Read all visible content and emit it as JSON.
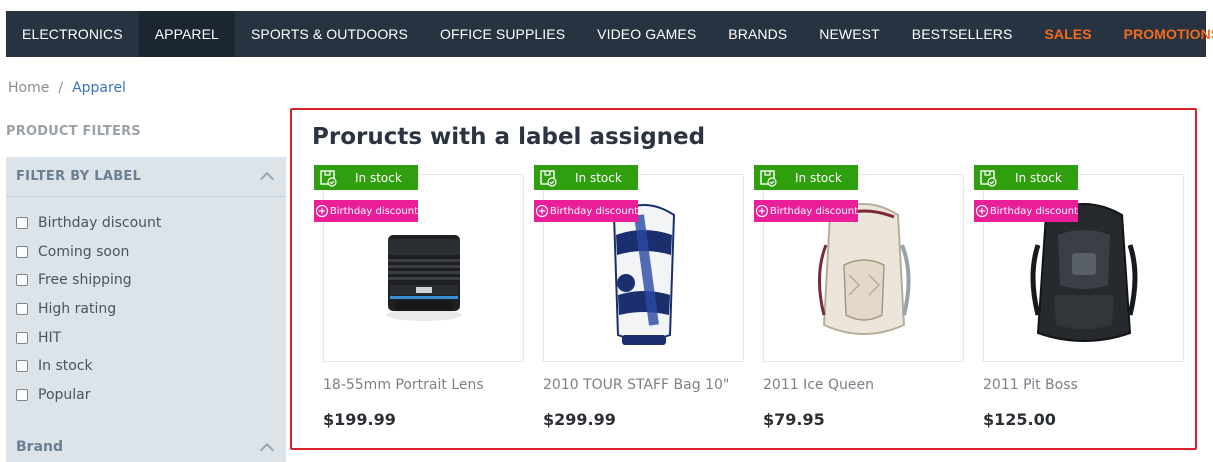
{
  "nav": {
    "items": [
      {
        "label": "ELECTRONICS"
      },
      {
        "label": "APPAREL"
      },
      {
        "label": "SPORTS & OUTDOORS"
      },
      {
        "label": "OFFICE SUPPLIES"
      },
      {
        "label": "VIDEO GAMES"
      },
      {
        "label": "BRANDS"
      },
      {
        "label": "NEWEST"
      },
      {
        "label": "BESTSELLERS"
      },
      {
        "label": "SALES"
      },
      {
        "label": "PROMOTIONS"
      }
    ]
  },
  "breadcrumb": {
    "home": "Home",
    "separator": "/",
    "current": "Apparel"
  },
  "sidebar": {
    "title": "PRODUCT FILTERS",
    "label_filter": {
      "title": "FILTER BY LABEL",
      "options": [
        "Birthday discount",
        "Coming soon",
        "Free shipping",
        "High rating",
        "HIT",
        "In stock",
        "Popular"
      ]
    },
    "brand": {
      "title": "Brand"
    }
  },
  "section": {
    "title": "Proructs with a label assigned"
  },
  "products": [
    {
      "name": "18-55mm Portrait Lens",
      "price": "$199.99",
      "stock_label": "In stock",
      "promo_label": "Birthday discount"
    },
    {
      "name": "2010 TOUR STAFF Bag 10\"",
      "price": "$299.99",
      "stock_label": "In stock",
      "promo_label": "Birthday discount"
    },
    {
      "name": "2011 Ice Queen",
      "price": "$79.95",
      "stock_label": "In stock",
      "promo_label": "Birthday discount"
    },
    {
      "name": "2011 Pit Boss",
      "price": "$125.00",
      "stock_label": "In stock",
      "promo_label": "Birthday discount"
    }
  ],
  "colors": {
    "nav_bg": "#273341",
    "accent_orange": "#f26a1b",
    "stock_green": "#2f9e0f",
    "promo_pink": "#ea1e98",
    "highlight_red": "#d9202b",
    "link_blue": "#3d73b8"
  }
}
